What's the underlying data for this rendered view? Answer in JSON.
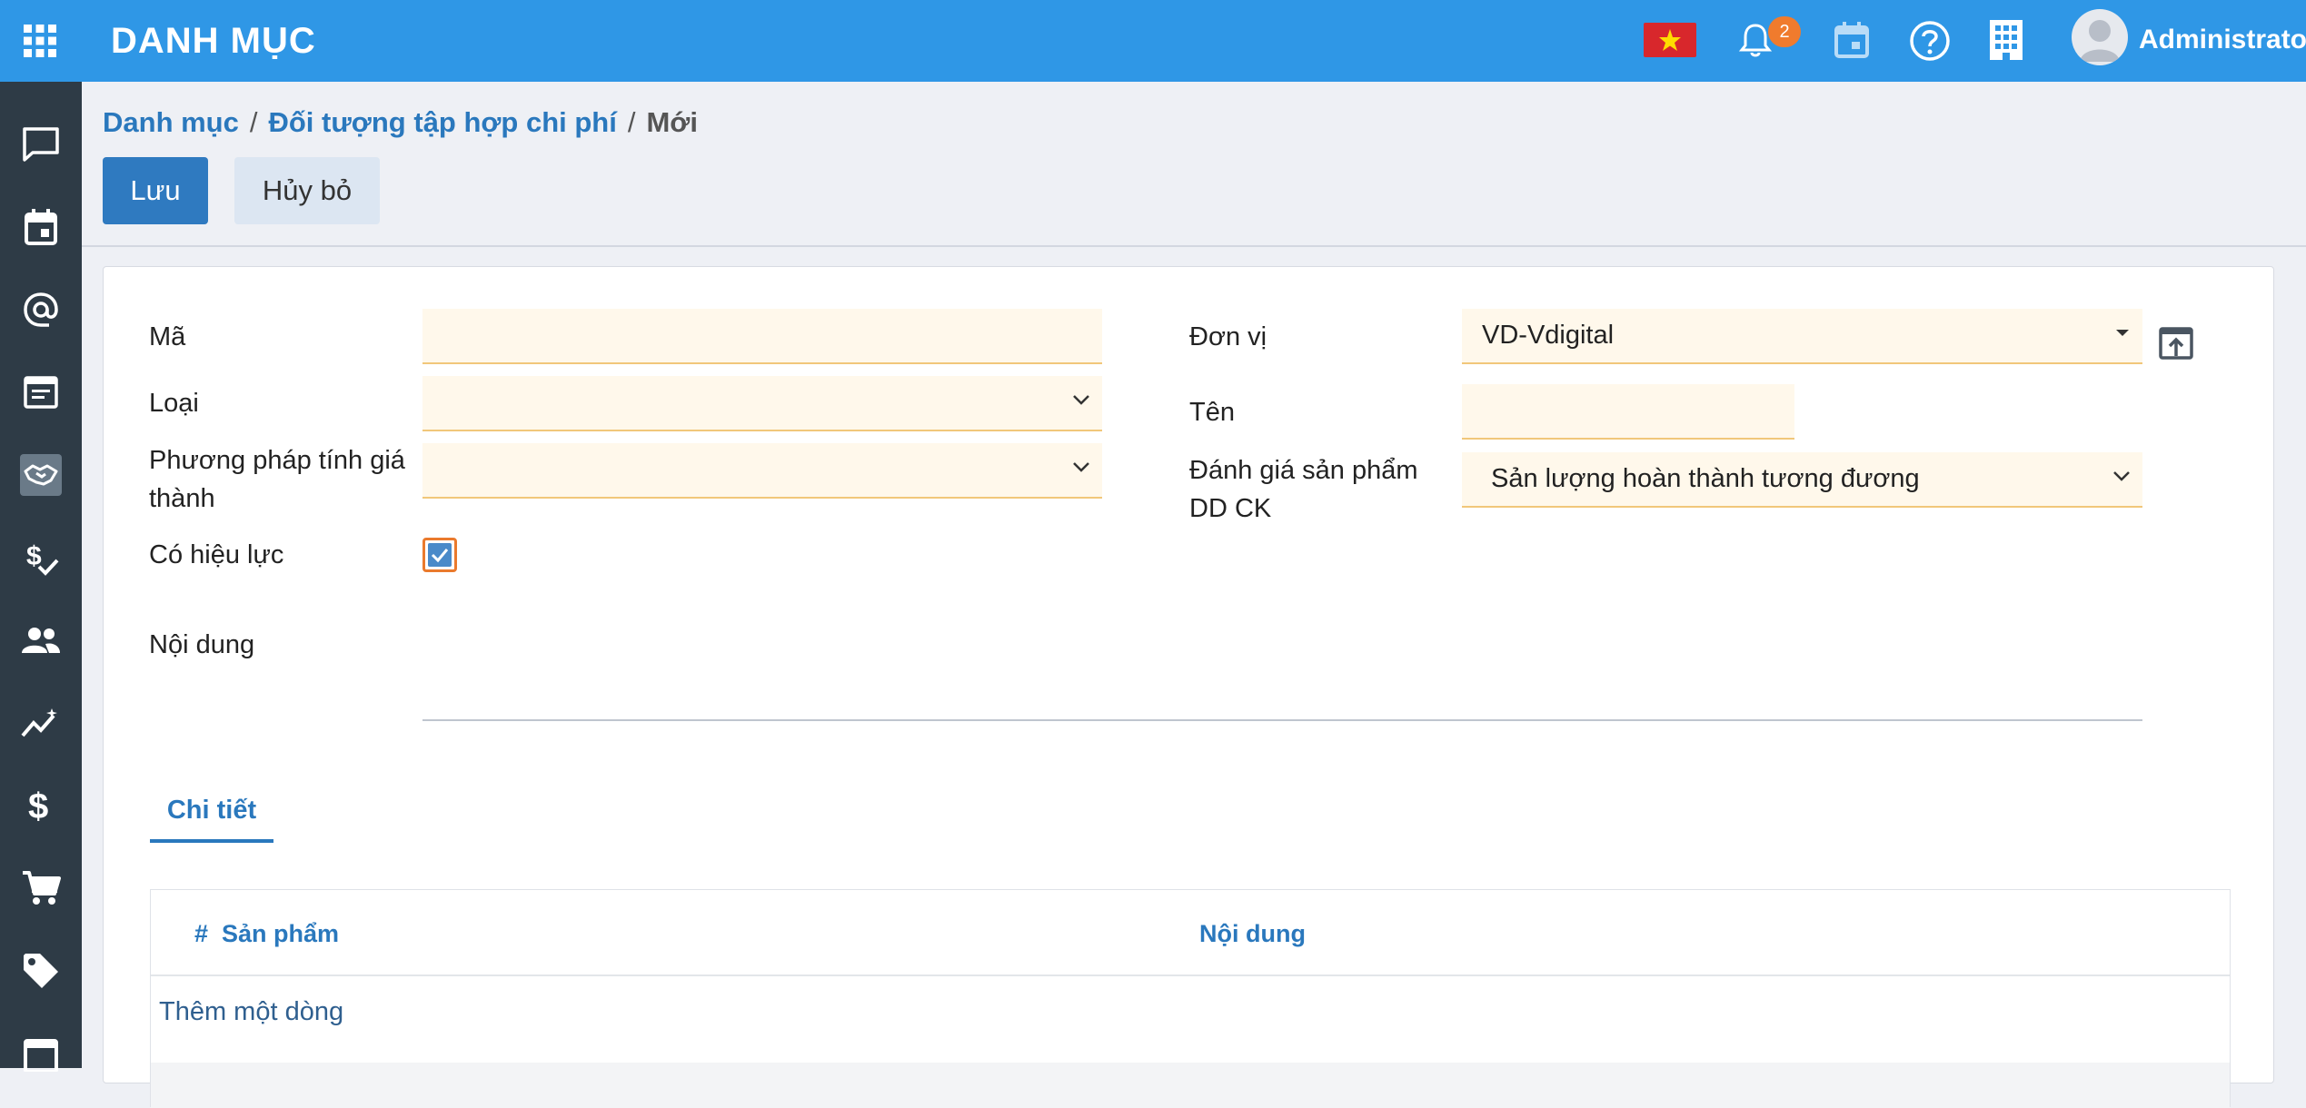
{
  "topbar": {
    "title": "DANH MỤC",
    "notification_count": "2",
    "user_name": "Administrator"
  },
  "breadcrumb": {
    "root": "Danh mục",
    "parent": "Đối tượng tập hợp chi phí",
    "current": "Mới",
    "separator": "/"
  },
  "actions": {
    "save_label": "Lưu",
    "cancel_label": "Hủy bỏ"
  },
  "form": {
    "code_label": "Mã",
    "code_value": "",
    "type_label": "Loại",
    "type_value": "",
    "method_label_line1": "Phương pháp tính giá",
    "method_label_line2": "thành",
    "method_value": "",
    "active_label": "Có hiệu lực",
    "active_checked": true,
    "unit_label": "Đơn vị",
    "unit_value": "VD-Vdigital",
    "name_label": "Tên",
    "name_value": "",
    "eval_label_line1": "Đánh giá sản phẩm",
    "eval_label_line2": "DD CK",
    "eval_value": "Sản lượng hoàn thành tương đương",
    "content_label": "Nội dung",
    "content_value": ""
  },
  "tabs": [
    {
      "label": "Chi tiết",
      "active": true
    }
  ],
  "detail_table": {
    "columns": [
      "#",
      "Sản phẩm",
      "Nội dung"
    ],
    "rows": [],
    "add_line_label": "Thêm một dòng"
  },
  "colors": {
    "topbar": "#2f97e6",
    "sidebar": "#2e3b46",
    "primary_button": "#2f7ac0",
    "link": "#2a78bd",
    "required_field_bg": "#fff8eb",
    "badge": "#f07b2d"
  },
  "icons": {
    "sidebar": [
      "chat-icon",
      "calendar-icon",
      "at-icon",
      "article-icon",
      "handshake-icon",
      "money-check-icon",
      "people-icon",
      "trending-icon",
      "dollar-icon",
      "cart-icon",
      "tag-icon",
      "list-icon"
    ]
  }
}
